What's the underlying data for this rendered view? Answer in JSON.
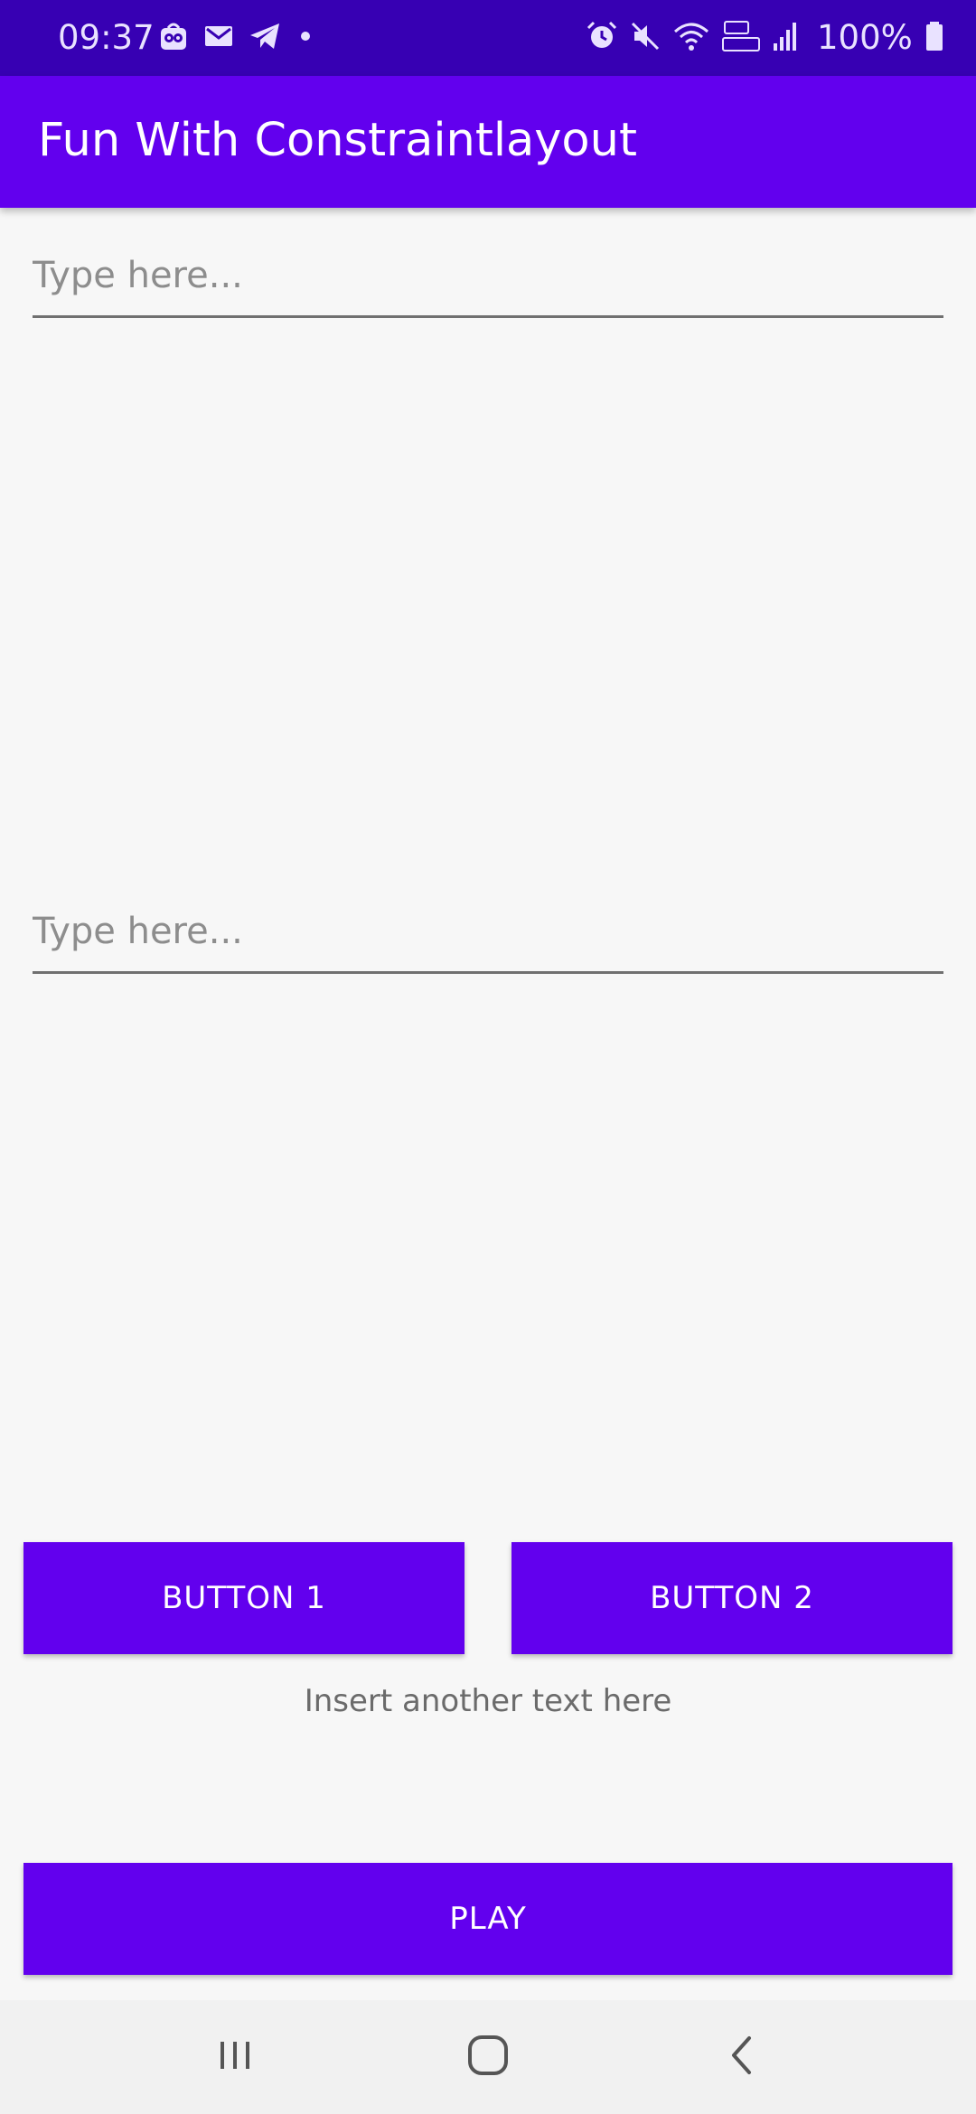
{
  "status_bar": {
    "time": "09:37",
    "battery": "100%",
    "left_icons": [
      "app-notification-icon",
      "mail-icon",
      "telegram-icon",
      "dot-icon"
    ],
    "right_icons": [
      "alarm-icon",
      "mute-icon",
      "wifi-icon",
      "volte-lte-icon",
      "signal-icon",
      "battery-icon"
    ]
  },
  "app_bar": {
    "title": "Fun With Constraintlayout"
  },
  "fields": {
    "first_placeholder": "Type here...",
    "second_placeholder": "Type here..."
  },
  "buttons": {
    "button1": "BUTTON 1",
    "button2": "BUTTON 2",
    "play": "PLAY"
  },
  "info_text": "Insert another text here",
  "nav_bar": {
    "icons": [
      "recents-icon",
      "home-icon",
      "back-icon"
    ]
  },
  "colors": {
    "status_bar": "#3700b3",
    "primary": "#6200ee",
    "background": "#f7f7f7",
    "nav_bar": "#f1f1f1"
  }
}
